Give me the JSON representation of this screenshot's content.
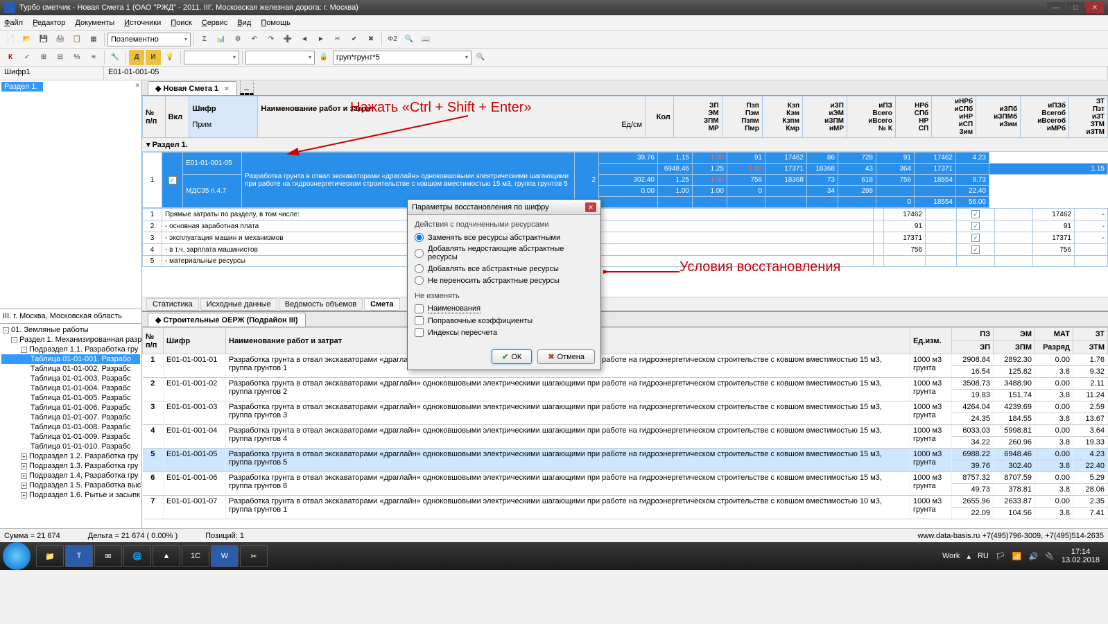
{
  "title": "Турбо сметчик - Новая Смета 1 (ОАО \"РЖД\" - 2011. III'. Московская железная дорога: г. Москва)",
  "menu": [
    "Файл",
    "Редактор",
    "Документы",
    "Источники",
    "Поиск",
    "Сервис",
    "Вид",
    "Помощь"
  ],
  "combo1": "Поэлементно",
  "combo2": "груп*грунт*5",
  "name_row": {
    "c1": "Шифр1",
    "c2": "E01-01-001-05"
  },
  "lefttop_hl": "Раздел 1.",
  "leftmid": "III. г. Москва, Московская область",
  "tree": [
    {
      "lvl": 0,
      "tog": "-",
      "txt": "01. Земляные работы"
    },
    {
      "lvl": 1,
      "tog": "-",
      "txt": "Раздел 1. Механизированная разр"
    },
    {
      "lvl": 2,
      "tog": "-",
      "txt": "Подраздел 1.1. Разработка гру"
    },
    {
      "lvl": 3,
      "txt": "Таблица 01-01-001. Разрабо",
      "sel": true
    },
    {
      "lvl": 3,
      "txt": "Таблица 01-01-002. Разрабс"
    },
    {
      "lvl": 3,
      "txt": "Таблица 01-01-003. Разрабс"
    },
    {
      "lvl": 3,
      "txt": "Таблица 01-01-004. Разрабс"
    },
    {
      "lvl": 3,
      "txt": "Таблица 01-01-005. Разрабс"
    },
    {
      "lvl": 3,
      "txt": "Таблица 01-01-006. Разрабс"
    },
    {
      "lvl": 3,
      "txt": "Таблица 01-01-007. Разрабс"
    },
    {
      "lvl": 3,
      "txt": "Таблица 01-01-008. Разрабс"
    },
    {
      "lvl": 3,
      "txt": "Таблица 01-01-009. Разрабс"
    },
    {
      "lvl": 3,
      "txt": "Таблица 01-01-010. Разрабс"
    },
    {
      "lvl": 2,
      "tog": "+",
      "txt": "Подраздел 1.2. Разработка гру"
    },
    {
      "lvl": 2,
      "tog": "+",
      "txt": "Подраздел 1.3. Разработка гру"
    },
    {
      "lvl": 2,
      "tog": "+",
      "txt": "Подраздел 1.4. Разработка гру"
    },
    {
      "lvl": 2,
      "tog": "+",
      "txt": "Подраздел 1.5. Разработка выє"
    },
    {
      "lvl": 2,
      "tog": "+",
      "txt": "Подраздел 1.6. Рытье и засыпк"
    }
  ],
  "tab_main": "Новая Смета 1",
  "ghead": {
    "np": "№\nп/п",
    "vkl": "Вкл",
    "shifr": "Шифр",
    "prim": "Прим",
    "name": "Наименование работ и затрат",
    "kol": "Кол",
    "edsm": "Ед/см",
    "c1": [
      "ЗП",
      "ЭМ",
      "ЗПМ",
      "МР"
    ],
    "c2": [
      "Пзп",
      "Пэм",
      "Пзпм",
      "Пмр"
    ],
    "c3": [
      "Кзп",
      "Кэм",
      "Кзпм",
      "Кмр"
    ],
    "c4": [
      "иЗП",
      "иЭМ",
      "иЗПМ",
      "иМР"
    ],
    "c5": [
      "иПЗ",
      "Всего",
      "иВсего",
      "№ К"
    ],
    "c6": [
      "НРб",
      "СПб",
      "НР",
      "СП"
    ],
    "c7": [
      "иНРб",
      "иСПб",
      "иНР",
      "иСП",
      "Зим"
    ],
    "c8": [
      "иЗПб",
      "иЗПМб",
      "иЗим"
    ],
    "c9": [
      "иПЗб",
      "Всегоб",
      "иВсегоб",
      "иМРб"
    ],
    "c10": [
      "ЗТ",
      "Пзт",
      "иЗТ",
      "ЗТМ",
      "иЗТМ"
    ]
  },
  "annot1": "Нажать «Ctrl + Shift + Enter»",
  "annot2": "Условия восстановления",
  "section": "Раздел 1.",
  "bluerow": {
    "np": "1",
    "chk": "✓",
    "shifr": "E01-01-001-05",
    "prim": "МДС35 п.4.7",
    "name": "Разработка грунта в отвал экскаваторами «драглайн» одноковшовыми электрическими шагающими при работе на гидроэнергетическом строительстве с ковшом вместимостью 15 м3, группа грунтов 5",
    "kol": "2",
    "vals": [
      [
        "39.76",
        "1.15",
        "1.00",
        "91",
        "17462",
        "86",
        "728",
        "91",
        "17462",
        "4.23"
      ],
      [
        "6948.46",
        "1.25",
        "1.00",
        "17371",
        "18368",
        "43",
        "364",
        "17371",
        "",
        "1.15"
      ],
      [
        "302.40",
        "1.25",
        "1.00",
        "756",
        "18368",
        "73",
        "618",
        "756",
        "18554",
        "9.73"
      ],
      [
        "0.00",
        "1.00",
        "1.00",
        "0",
        "",
        "34",
        "288",
        "",
        "",
        "22.40"
      ],
      [
        "",
        "",
        "",
        "",
        "",
        "",
        "",
        "0",
        "18554",
        "56.00"
      ]
    ]
  },
  "sumrows": [
    {
      "n": "1",
      "t": "Прямые затраты по разделу, в том числе:",
      "v": "17462",
      "v2": "17462",
      "d": "-"
    },
    {
      "n": "2",
      "t": "- основная заработная плата",
      "v": "91",
      "v2": "91",
      "d": "-"
    },
    {
      "n": "3",
      "t": "- эксплуатация машин и механизмов",
      "v": "17371",
      "v2": "17371",
      "d": "-"
    },
    {
      "n": "4",
      "t": "  - в т.ч. зарплата машинистов",
      "v": "756",
      "v2": "756",
      "d": ""
    },
    {
      "n": "5",
      "t": "- материальные ресурсы",
      "v": "",
      "v2": "",
      "d": ""
    }
  ],
  "bottabs": [
    "Статистика",
    "Исходные данные",
    "Ведомость объемов",
    "Смета"
  ],
  "bottabs_active": 3,
  "grid2_title": "Строительные ОЕРЖ (Подрайон III)",
  "g2head": {
    "np": "№\nп/п",
    "shifr": "Шифр",
    "name": "Наименование работ и затрат",
    "ed": "Ед.изм.",
    "pz": "ПЗ",
    "zp": "ЗП",
    "em": "ЭМ",
    "zpm": "ЗПМ",
    "mat": "МАТ",
    "raz": "Разряд",
    "zt": "ЗТ",
    "ztm": "ЗТМ"
  },
  "g2rows": [
    {
      "n": "1",
      "s": "E01-01-001-01",
      "nm": "Разработка грунта в отвал экскаваторами «драглайн» одноковшовыми электрическими шагающими при работе на гидроэнергетическом строительстве с ковшом вместимостью 15 м3, группа грунтов 1",
      "ed": "1000 м3 грунта",
      "r1": [
        "2908.84",
        "2892.30",
        "0.00",
        "1.76"
      ],
      "r2": [
        "16.54",
        "125.82",
        "3.8",
        "9.32"
      ]
    },
    {
      "n": "2",
      "s": "E01-01-001-02",
      "nm": "Разработка грунта в отвал экскаваторами «драглайн» одноковшовыми электрическими шагающими при работе на гидроэнергетическом строительстве с ковшом вместимостью 15 м3, группа грунтов 2",
      "ed": "1000 м3 грунта",
      "r1": [
        "3508.73",
        "3488.90",
        "0.00",
        "2.11"
      ],
      "r2": [
        "19.83",
        "151.74",
        "3.8",
        "11.24"
      ]
    },
    {
      "n": "3",
      "s": "E01-01-001-03",
      "nm": "Разработка грунта в отвал экскаваторами «драглайн» одноковшовыми электрическими шагающими при работе на гидроэнергетическом строительстве с ковшом вместимостью 15 м3, группа грунтов 3",
      "ed": "1000 м3 грунта",
      "r1": [
        "4264.04",
        "4239.69",
        "0.00",
        "2.59"
      ],
      "r2": [
        "24.35",
        "184.55",
        "3.8",
        "13.67"
      ]
    },
    {
      "n": "4",
      "s": "E01-01-001-04",
      "nm": "Разработка грунта в отвал экскаваторами «драглайн» одноковшовыми электрическими шагающими при работе на гидроэнергетическом строительстве с ковшом вместимостью 15 м3, группа грунтов 4",
      "ed": "1000 м3 грунта",
      "r1": [
        "6033.03",
        "5998.81",
        "0.00",
        "3.64"
      ],
      "r2": [
        "34.22",
        "260.96",
        "3.8",
        "19.33"
      ]
    },
    {
      "n": "5",
      "s": "E01-01-001-05",
      "nm": "Разработка грунта в отвал экскаваторами «драглайн» одноковшовыми электрическими шагающими при работе на гидроэнергетическом строительстве с ковшом вместимостью 15 м3, группа грунтов 5",
      "ed": "1000 м3 грунта",
      "r1": [
        "6988.22",
        "6948.46",
        "0.00",
        "4.23"
      ],
      "r2": [
        "39.76",
        "302.40",
        "3.8",
        "22.40"
      ],
      "hl": true
    },
    {
      "n": "6",
      "s": "E01-01-001-06",
      "nm": "Разработка грунта в отвал экскаваторами «драглайн» одноковшовыми электрическими шагающими при работе на гидроэнергетическом строительстве с ковшом вместимостью 15 м3, группа грунтов 6",
      "ed": "1000 м3 грунта",
      "r1": [
        "8757.32",
        "8707.59",
        "0.00",
        "5.29"
      ],
      "r2": [
        "49.73",
        "378.81",
        "3.8",
        "28.06"
      ]
    },
    {
      "n": "7",
      "s": "E01-01-001-07",
      "nm": "Разработка грунта в отвал экскаваторами «драглайн» одноковшовыми электрическими шагающими при работе на гидроэнергетическом строительстве с ковшом вместимостью 10 м3, группа грунтов 1",
      "ed": "1000 м3 грунта",
      "r1": [
        "2655.96",
        "2633.87",
        "0.00",
        "2.35"
      ],
      "r2": [
        "22.09",
        "104.56",
        "3.8",
        "7.41"
      ]
    }
  ],
  "status": {
    "sum": "Сумма = 21 674",
    "delta": "Дельта = 21 674 ( 0.00% )",
    "pos": "Позиций: 1",
    "right": "www.data-basis.ru  +7(495)796-3009, +7(495)514-2635"
  },
  "dialog": {
    "title": "Параметры восстановления по шифру",
    "grp1": "Действия с подчиненными ресурсами",
    "opts": [
      "Заменять все ресурсы абстрактными",
      "Добавлять недостающие абстрактные ресурсы",
      "Добавлять все абстрактные ресурсы",
      "Не переносить абстрактные ресурсы"
    ],
    "grp2": "Не изменять",
    "chks": [
      "Наименования",
      "Поправочные коэффициенты",
      "Индексы пересчета"
    ],
    "ok": "ОК",
    "cancel": "Отмена"
  },
  "tray": {
    "work": "Work",
    "lang": "RU",
    "time": "17:14",
    "date": "13.02.2018"
  }
}
